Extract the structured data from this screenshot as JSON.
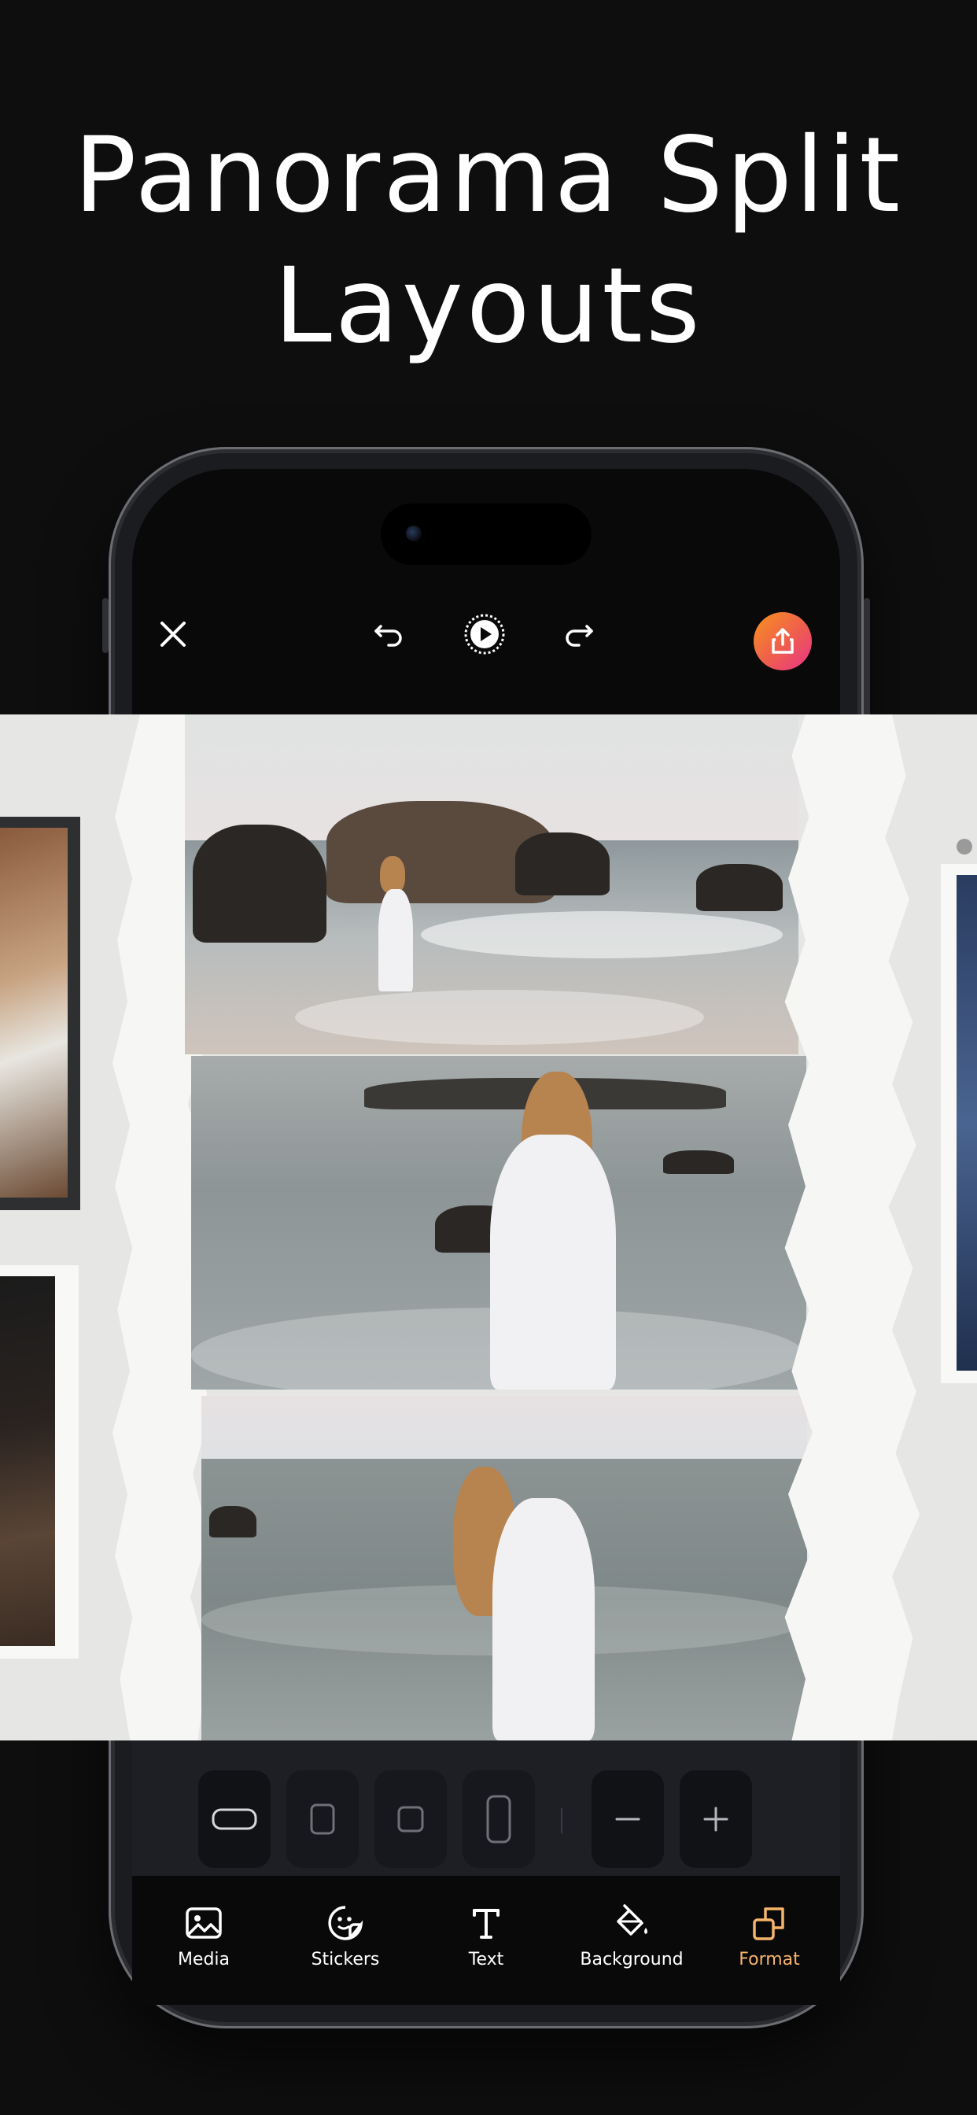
{
  "headline": {
    "line1": "Panorama Split",
    "line2": "Layouts"
  },
  "colors": {
    "background": "#0e0e0f",
    "accent": "#f6b46b",
    "export_gradient": [
      "#f7931e",
      "#e8338a"
    ]
  },
  "toolbar": {
    "close_icon": "close-icon",
    "undo_icon": "undo-icon",
    "play_icon": "play-icon",
    "redo_icon": "redo-icon",
    "export_icon": "share-export-icon"
  },
  "format_bar": {
    "options": [
      {
        "icon": "wide-ratio-icon",
        "selected": true
      },
      {
        "icon": "portrait-ratio-icon",
        "selected": false
      },
      {
        "icon": "square-ratio-icon",
        "selected": false
      },
      {
        "icon": "tall-ratio-icon",
        "selected": false
      }
    ],
    "decrease_icon": "minus-icon",
    "increase_icon": "plus-icon"
  },
  "tabs": [
    {
      "label": "Media",
      "icon": "image-icon",
      "active": false
    },
    {
      "label": "Stickers",
      "icon": "sticker-icon",
      "active": false
    },
    {
      "label": "Text",
      "icon": "text-icon",
      "active": false
    },
    {
      "label": "Background",
      "icon": "paint-bucket-icon",
      "active": false
    },
    {
      "label": "Format",
      "icon": "format-icon",
      "active": true
    }
  ]
}
